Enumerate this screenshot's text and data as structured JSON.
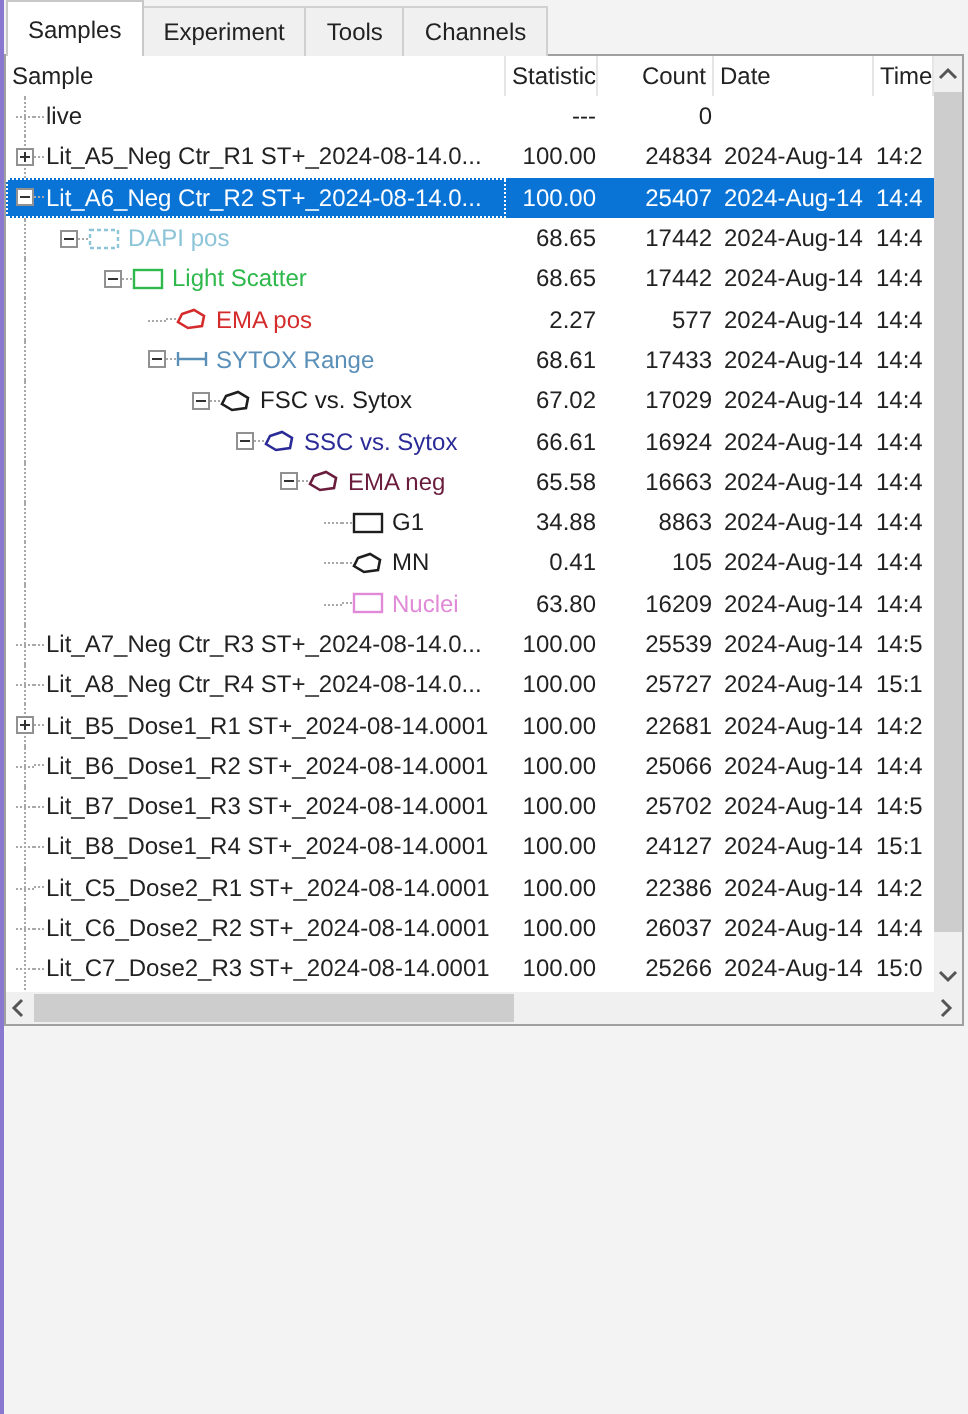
{
  "tabs": [
    {
      "label": "Samples",
      "selected": true
    },
    {
      "label": "Experiment",
      "selected": false
    },
    {
      "label": "Tools",
      "selected": false
    },
    {
      "label": "Channels",
      "selected": false
    }
  ],
  "table": {
    "columns": [
      "Sample",
      "Statistic",
      "Count",
      "Date",
      "Time"
    ],
    "samples": [
      {
        "name": "live",
        "statistic": "---",
        "count": "0",
        "selected": false
      },
      {
        "name": "Lit_A5_Neg Ctr_R1 ST+_2024-08-14.0...",
        "statistic": "100.00",
        "count": "24834",
        "date": "2024-Aug-14",
        "time": "14:2",
        "expanded": false,
        "selected": false
      },
      {
        "name": "Lit_A6_Neg Ctr_R2 ST+_2024-08-14.0...",
        "statistic": "100.00",
        "count": "25407",
        "date": "2024-Aug-14",
        "time": "14:4",
        "expanded": true,
        "selected": true,
        "children": [
          {
            "name": "DAPI pos",
            "kind": "dashed-rectangle",
            "color": "#8cc4d8",
            "statistic": "68.65",
            "count": "17442",
            "date": "2024-Aug-14",
            "time": "14:4",
            "expanded": true,
            "children": [
              {
                "name": "Light Scatter",
                "kind": "rectangle",
                "color": "#2fb84c",
                "statistic": "68.65",
                "count": "17442",
                "date": "2024-Aug-14",
                "time": "14:4",
                "expanded": true,
                "children": [
                  {
                    "name": "EMA pos",
                    "kind": "polygon",
                    "color": "#d42c2c",
                    "statistic": "2.27",
                    "count": "577",
                    "date": "2024-Aug-14",
                    "time": "14:4"
                  },
                  {
                    "name": "SYTOX Range",
                    "kind": "range",
                    "color": "#5a8fb8",
                    "statistic": "68.61",
                    "count": "17433",
                    "date": "2024-Aug-14",
                    "time": "14:4",
                    "expanded": true,
                    "children": [
                      {
                        "name": "FSC vs. Sytox",
                        "kind": "polygon",
                        "color": "#1e1e1e",
                        "statistic": "67.02",
                        "count": "17029",
                        "date": "2024-Aug-14",
                        "time": "14:4",
                        "expanded": true,
                        "children": [
                          {
                            "name": "SSC vs. Sytox",
                            "kind": "polygon",
                            "color": "#2b2b98",
                            "statistic": "66.61",
                            "count": "16924",
                            "date": "2024-Aug-14",
                            "time": "14:4",
                            "expanded": true,
                            "children": [
                              {
                                "name": "EMA neg",
                                "kind": "polygon",
                                "color": "#6a1c3c",
                                "statistic": "65.58",
                                "count": "16663",
                                "date": "2024-Aug-14",
                                "time": "14:4",
                                "expanded": true,
                                "children": [
                                  {
                                    "name": "G1",
                                    "kind": "rectangle",
                                    "color": "#1e1e1e",
                                    "statistic": "34.88",
                                    "count": "8863",
                                    "date": "2024-Aug-14",
                                    "time": "14:4"
                                  },
                                  {
                                    "name": "MN",
                                    "kind": "polygon",
                                    "color": "#1e1e1e",
                                    "statistic": "0.41",
                                    "count": "105",
                                    "date": "2024-Aug-14",
                                    "time": "14:4"
                                  },
                                  {
                                    "name": "Nuclei",
                                    "kind": "rectangle",
                                    "color": "#e08ad8",
                                    "statistic": "63.80",
                                    "count": "16209",
                                    "date": "2024-Aug-14",
                                    "time": "14:4"
                                  }
                                ]
                              }
                            ]
                          }
                        ]
                      }
                    ]
                  }
                ]
              }
            ]
          }
        ]
      },
      {
        "name": "Lit_A7_Neg Ctr_R3 ST+_2024-08-14.0...",
        "statistic": "100.00",
        "count": "25539",
        "date": "2024-Aug-14",
        "time": "14:5",
        "selected": false
      },
      {
        "name": "Lit_A8_Neg Ctr_R4 ST+_2024-08-14.0...",
        "statistic": "100.00",
        "count": "25727",
        "date": "2024-Aug-14",
        "time": "15:1",
        "selected": false
      },
      {
        "name": "Lit_B5_Dose1_R1 ST+_2024-08-14.0001",
        "statistic": "100.00",
        "count": "22681",
        "date": "2024-Aug-14",
        "time": "14:2",
        "expanded": false,
        "selected": false
      },
      {
        "name": "Lit_B6_Dose1_R2 ST+_2024-08-14.0001",
        "statistic": "100.00",
        "count": "25066",
        "date": "2024-Aug-14",
        "time": "14:4",
        "selected": false
      },
      {
        "name": "Lit_B7_Dose1_R3 ST+_2024-08-14.0001",
        "statistic": "100.00",
        "count": "25702",
        "date": "2024-Aug-14",
        "time": "14:5",
        "selected": false
      },
      {
        "name": "Lit_B8_Dose1_R4 ST+_2024-08-14.0001",
        "statistic": "100.00",
        "count": "24127",
        "date": "2024-Aug-14",
        "time": "15:1",
        "selected": false
      },
      {
        "name": "Lit_C5_Dose2_R1 ST+_2024-08-14.0001",
        "statistic": "100.00",
        "count": "22386",
        "date": "2024-Aug-14",
        "time": "14:2",
        "selected": false
      },
      {
        "name": "Lit_C6_Dose2_R2 ST+_2024-08-14.0001",
        "statistic": "100.00",
        "count": "26037",
        "date": "2024-Aug-14",
        "time": "14:4",
        "selected": false
      },
      {
        "name": "Lit_C7_Dose2_R3 ST+_2024-08-14.0001",
        "statistic": "100.00",
        "count": "25266",
        "date": "2024-Aug-14",
        "time": "15:0",
        "selected": false
      }
    ]
  }
}
